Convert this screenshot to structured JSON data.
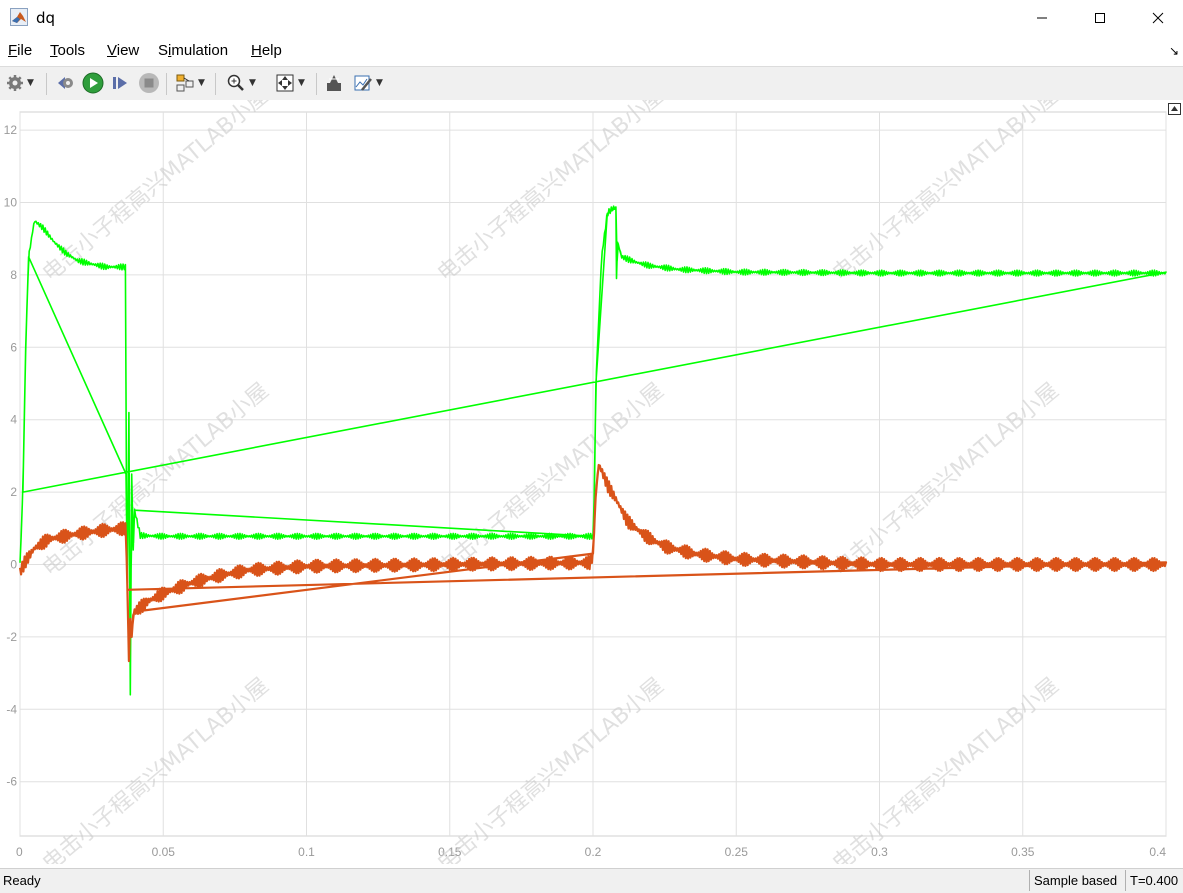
{
  "window": {
    "title": "dq"
  },
  "menu": [
    "File",
    "Tools",
    "View",
    "Simulation",
    "Help"
  ],
  "menu_mnemonics": [
    "F",
    "T",
    "V",
    "i",
    "H"
  ],
  "toolbar_icons": [
    "gear-icon",
    "step-back-icon",
    "run-icon",
    "step-forward-icon",
    "stop-icon",
    "highlight-block-icon",
    "zoom-in-icon",
    "fit-to-view-icon",
    "restore-style-icon",
    "edit-style-icon"
  ],
  "status": {
    "left": "Ready",
    "mode": "Sample based",
    "time": "T=0.400"
  },
  "watermark": "电击小子程高兴MATLAB小屋",
  "colors": {
    "series_d": "#00ff00",
    "series_q": "#d95319",
    "grid": "#e0e0e0",
    "axis_text": "#9a9a9a"
  },
  "chart_data": {
    "type": "line",
    "xlim": [
      0,
      0.4
    ],
    "ylim": [
      -7.5,
      12.5
    ],
    "xticks": [
      0,
      0.05,
      0.1,
      0.15,
      0.2,
      0.25,
      0.3,
      0.35,
      0.4
    ],
    "xtick_labels": [
      "0",
      "0.05",
      "0.1",
      "0.15",
      "0.2",
      "0.25",
      "0.3",
      "0.35",
      "0.4"
    ],
    "yticks": [
      -6,
      -4,
      -2,
      0,
      2,
      4,
      6,
      8,
      10,
      12
    ],
    "ytick_labels": [
      "-6",
      "-4",
      "-2",
      "0",
      "2",
      "4",
      "6",
      "8",
      "10",
      "12"
    ],
    "grid": true,
    "series": [
      {
        "color": "#00ff00",
        "x": [
          0,
          0.001,
          0.002,
          0.003,
          0.005,
          0.008,
          0.012,
          0.016,
          0.02,
          0.025,
          0.03,
          0.0368,
          0.037,
          0.0375,
          0.038,
          0.0385,
          0.039,
          0.0395,
          0.04,
          0.042,
          0.05,
          0.1,
          0.15,
          0.199,
          0.2,
          0.2005,
          0.201,
          0.203,
          0.205,
          0.207,
          0.208,
          0.2082,
          0.2086,
          0.21,
          0.215,
          0.22,
          0.23,
          0.25,
          0.3,
          0.35,
          0.4
        ],
        "y": [
          0,
          2,
          6,
          8.5,
          9.5,
          9.3,
          8.9,
          8.6,
          8.4,
          8.3,
          8.22,
          8.22,
          2.5,
          -0.5,
          4.2,
          -3.6,
          2.5,
          0.4,
          1.5,
          0.8,
          0.78,
          0.78,
          0.78,
          0.78,
          0.78,
          2,
          5,
          8.5,
          9.7,
          9.85,
          9.85,
          7.9,
          8.9,
          8.5,
          8.35,
          8.25,
          8.15,
          8.08,
          8.05,
          8.05,
          8.05
        ]
      },
      {
        "color": "#d95319",
        "x": [
          0,
          0.002,
          0.005,
          0.01,
          0.02,
          0.03,
          0.037,
          0.0375,
          0.038,
          0.0385,
          0.039,
          0.0395,
          0.04,
          0.045,
          0.05,
          0.06,
          0.07,
          0.08,
          0.1,
          0.15,
          0.199,
          0.2,
          0.201,
          0.202,
          0.203,
          0.205,
          0.208,
          0.212,
          0.218,
          0.225,
          0.235,
          0.25,
          0.28,
          0.3,
          0.35,
          0.4
        ],
        "y": [
          -0.2,
          0.1,
          0.45,
          0.7,
          0.85,
          0.95,
          1.0,
          -0.7,
          -2.6,
          -1.5,
          -2.0,
          -1.4,
          -1.3,
          -1.0,
          -0.8,
          -0.5,
          -0.3,
          -0.15,
          -0.05,
          0,
          0.05,
          0.3,
          2.0,
          2.75,
          2.6,
          2.2,
          1.8,
          1.2,
          0.8,
          0.5,
          0.3,
          0.15,
          0.05,
          0,
          0,
          0
        ]
      }
    ]
  }
}
